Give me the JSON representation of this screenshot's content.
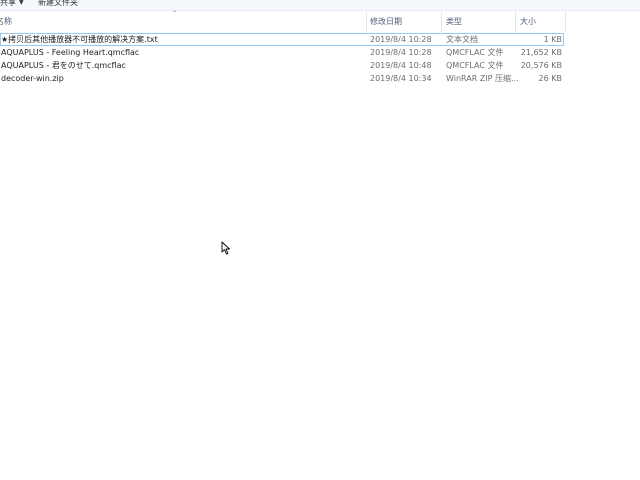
{
  "toolbar": {
    "share_label": "共享",
    "new_folder_label": "新建文件夹"
  },
  "columns": {
    "name": "名称",
    "date": "修改日期",
    "type": "类型",
    "size": "大小"
  },
  "files": [
    {
      "name": "★拷贝后其他播放器不可播放的解决方案.txt",
      "date": "2019/8/4 10:28",
      "type": "文本文档",
      "size": "1 KB"
    },
    {
      "name": "AQUAPLUS - Feeling Heart.qmcflac",
      "date": "2019/8/4 10:28",
      "type": "QMCFLAC 文件",
      "size": "21,652 KB"
    },
    {
      "name": "AQUAPLUS - 君をのせて.qmcflac",
      "date": "2019/8/4 10:48",
      "type": "QMCFLAC 文件",
      "size": "20,576 KB"
    },
    {
      "name": "decoder-win.zip",
      "date": "2019/8/4 10:34",
      "type": "WinRAR ZIP 压缩...",
      "size": "26 KB"
    }
  ],
  "icons": {
    "sort": "chevron-up-icon",
    "share_dropdown": "caret-down-icon",
    "cursor": "mouse-pointer-icon"
  },
  "colors": {
    "header_text": "#4c607a",
    "focus_outline": "#99c9ef",
    "toolbar_bg": "#f5f8fc"
  }
}
